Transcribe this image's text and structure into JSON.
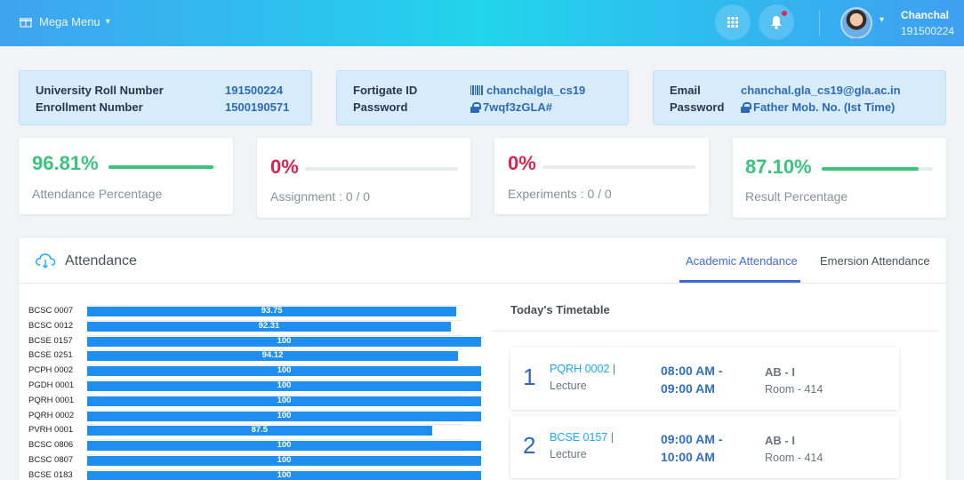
{
  "header": {
    "mega_menu_label": "Mega Menu",
    "user_name": "Chanchal",
    "user_roll": "191500224"
  },
  "info_cards": [
    {
      "rows": [
        {
          "label": "University Roll Number",
          "value": "191500224"
        },
        {
          "label": "Enrollment Number",
          "value": "1500190571"
        }
      ]
    },
    {
      "rows": [
        {
          "label": "Fortigate ID",
          "value": "chanchalgla_cs19",
          "icon": "barcode-icon"
        },
        {
          "label": "Password",
          "value": "7wqf3zGLA#",
          "icon": "lock-icon"
        }
      ]
    },
    {
      "rows": [
        {
          "label": "Email",
          "value": "chanchal.gla_cs19@gla.ac.in"
        },
        {
          "label": "Password",
          "value": "Father Mob. No. (Ist Time)",
          "icon": "lock-icon"
        }
      ]
    }
  ],
  "stats": [
    {
      "value": "96.81%",
      "label": "Attendance Percentage",
      "progress": 0.9681,
      "color": "#3ac47d"
    },
    {
      "value": "0%",
      "label": "Assignment : 0 / 0",
      "progress": 0,
      "color": "#d92550"
    },
    {
      "value": "0%",
      "label": "Experiments : 0 / 0",
      "progress": 0,
      "color": "#d92550"
    },
    {
      "value": "87.10%",
      "label": "Result Percentage",
      "progress": 0.871,
      "color": "#3ac47d"
    }
  ],
  "attendance": {
    "title": "Attendance",
    "tabs": [
      "Academic Attendance",
      "Emersion Attendance"
    ],
    "active_tab": 0
  },
  "chart_data": {
    "type": "bar",
    "orientation": "horizontal",
    "categories": [
      "BCSC 0007",
      "BCSC 0012",
      "BCSE 0157",
      "BCSE 0251",
      "PCPH 0002",
      "PGDH 0001",
      "PQRH 0001",
      "PQRH 0002",
      "PVRH 0001",
      "BCSC 0806",
      "BCSC 0807",
      "BCSE 0183"
    ],
    "values": [
      93.75,
      92.31,
      100,
      94.12,
      100,
      100,
      100,
      100,
      87.5,
      100,
      100,
      100
    ],
    "data_labels": [
      "93.75",
      "92.31",
      "100",
      "94.12",
      "100",
      "100",
      "100",
      "100",
      "87.5",
      "100",
      "100",
      "100"
    ],
    "xlim": [
      0,
      100
    ],
    "color": "#1e8ff0"
  },
  "timetable": {
    "title": "Today's Timetable",
    "entries": [
      {
        "index": "1",
        "code": "PQRH 0002",
        "type": "Lecture",
        "start": "08:00 AM -",
        "end": "09:00 AM",
        "section": "AB - I",
        "room": "Room - 414"
      },
      {
        "index": "2",
        "code": "BCSE 0157",
        "type": "Lecture",
        "start": "09:00 AM -",
        "end": "10:00 AM",
        "section": "AB - I",
        "room": "Room - 414"
      }
    ]
  }
}
